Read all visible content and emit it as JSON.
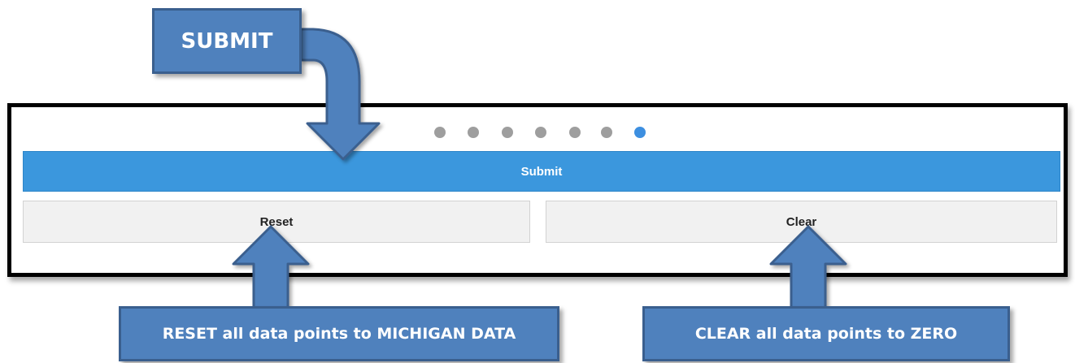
{
  "progress": {
    "total_steps": 7,
    "current_step": 7
  },
  "buttons": {
    "submit_label": "Submit",
    "reset_label": "Reset",
    "clear_label": "Clear"
  },
  "callouts": {
    "submit_text": "SUBMIT",
    "reset_text": "RESET all data points to MICHIGAN DATA",
    "clear_text": "CLEAR all data points to ZERO"
  },
  "colors": {
    "accent": "#3b97dd",
    "active_dot": "#3d8fe0",
    "inactive_dot": "#9e9e9e",
    "callout_fill": "#4f81bd",
    "callout_border": "#3a5f8e",
    "frame": "#000000"
  }
}
